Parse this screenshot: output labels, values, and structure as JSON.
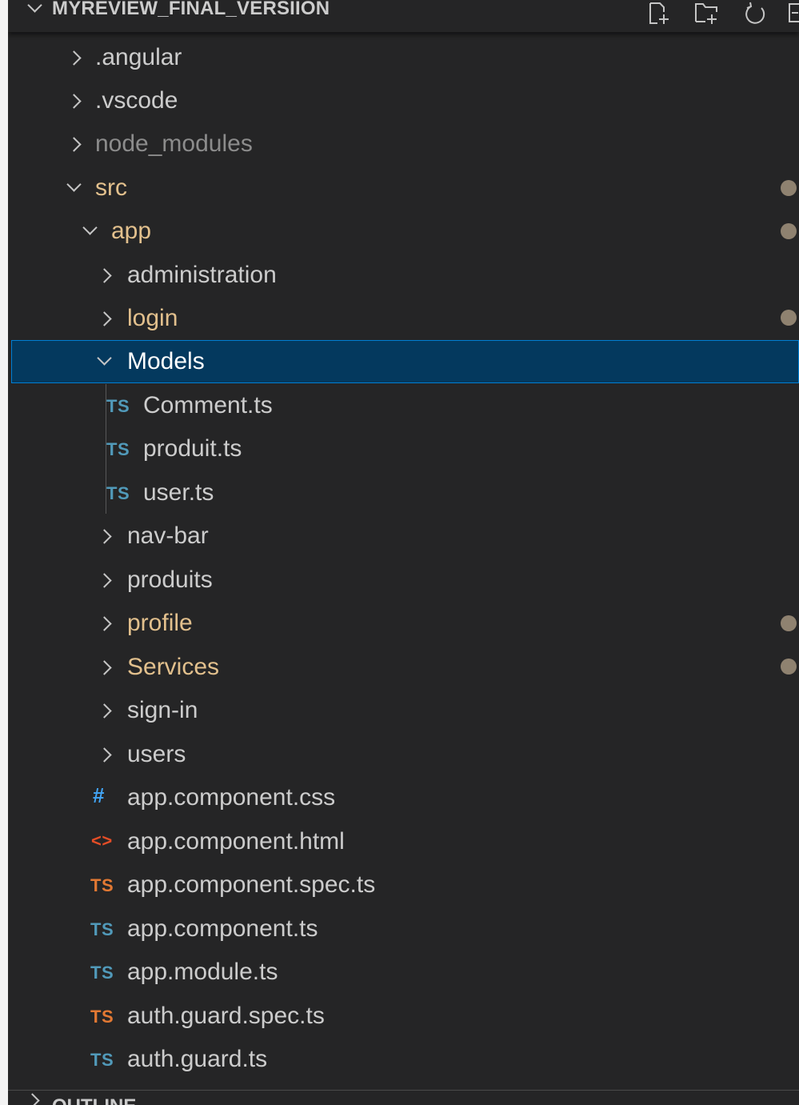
{
  "explorer": {
    "section_title": "MYREVIEW_FINAL_VERSIION",
    "actions": [
      {
        "name": "new-file-icon"
      },
      {
        "name": "new-folder-icon"
      },
      {
        "name": "refresh-icon"
      },
      {
        "name": "collapse-all-icon"
      }
    ],
    "items": [
      {
        "label": ".angular",
        "type": "folder",
        "expanded": false
      },
      {
        "label": ".vscode",
        "type": "folder",
        "expanded": false
      },
      {
        "label": "node_modules",
        "type": "folder",
        "expanded": false,
        "ignored": true
      },
      {
        "label": "src",
        "type": "folder",
        "expanded": true,
        "modified": true
      },
      {
        "label": "app",
        "type": "folder",
        "expanded": true,
        "modified": true
      },
      {
        "label": "administration",
        "type": "folder",
        "expanded": false
      },
      {
        "label": "login",
        "type": "folder",
        "expanded": false,
        "modified": true
      },
      {
        "label": "Models",
        "type": "folder",
        "expanded": true,
        "selected": true
      },
      {
        "label": "Comment.ts",
        "type": "file",
        "badge": "TS"
      },
      {
        "label": "produit.ts",
        "type": "file",
        "badge": "TS"
      },
      {
        "label": "user.ts",
        "type": "file",
        "badge": "TS"
      },
      {
        "label": "nav-bar",
        "type": "folder",
        "expanded": false
      },
      {
        "label": "produits",
        "type": "folder",
        "expanded": false
      },
      {
        "label": "profile",
        "type": "folder",
        "expanded": false,
        "modified": true
      },
      {
        "label": "Services",
        "type": "folder",
        "expanded": false,
        "modified": true
      },
      {
        "label": "sign-in",
        "type": "folder",
        "expanded": false
      },
      {
        "label": "users",
        "type": "folder",
        "expanded": false
      },
      {
        "label": "app.component.css",
        "type": "file",
        "badge": "#"
      },
      {
        "label": "app.component.html",
        "type": "file",
        "badge": "<>"
      },
      {
        "label": "app.component.spec.ts",
        "type": "file",
        "badge": "TS"
      },
      {
        "label": "app.component.ts",
        "type": "file",
        "badge": "TS"
      },
      {
        "label": "app.module.ts",
        "type": "file",
        "badge": "TS"
      },
      {
        "label": "auth.guard.spec.ts",
        "type": "file",
        "badge": "TS"
      },
      {
        "label": "auth.guard.ts",
        "type": "file",
        "badge": "TS"
      }
    ]
  },
  "outline": {
    "title": "OUTLINE"
  },
  "colors": {
    "sidebar_bg": "#252526",
    "text": "#cccccc",
    "muted": "#8c8c8c",
    "modified": "#e2c08d",
    "selected_bg": "#04395e",
    "selected_border": "#007fd4",
    "ts_blue": "#519aba",
    "ts_orange": "#e37933",
    "css_blue": "#42a5f5",
    "html_orange": "#e44d26"
  }
}
